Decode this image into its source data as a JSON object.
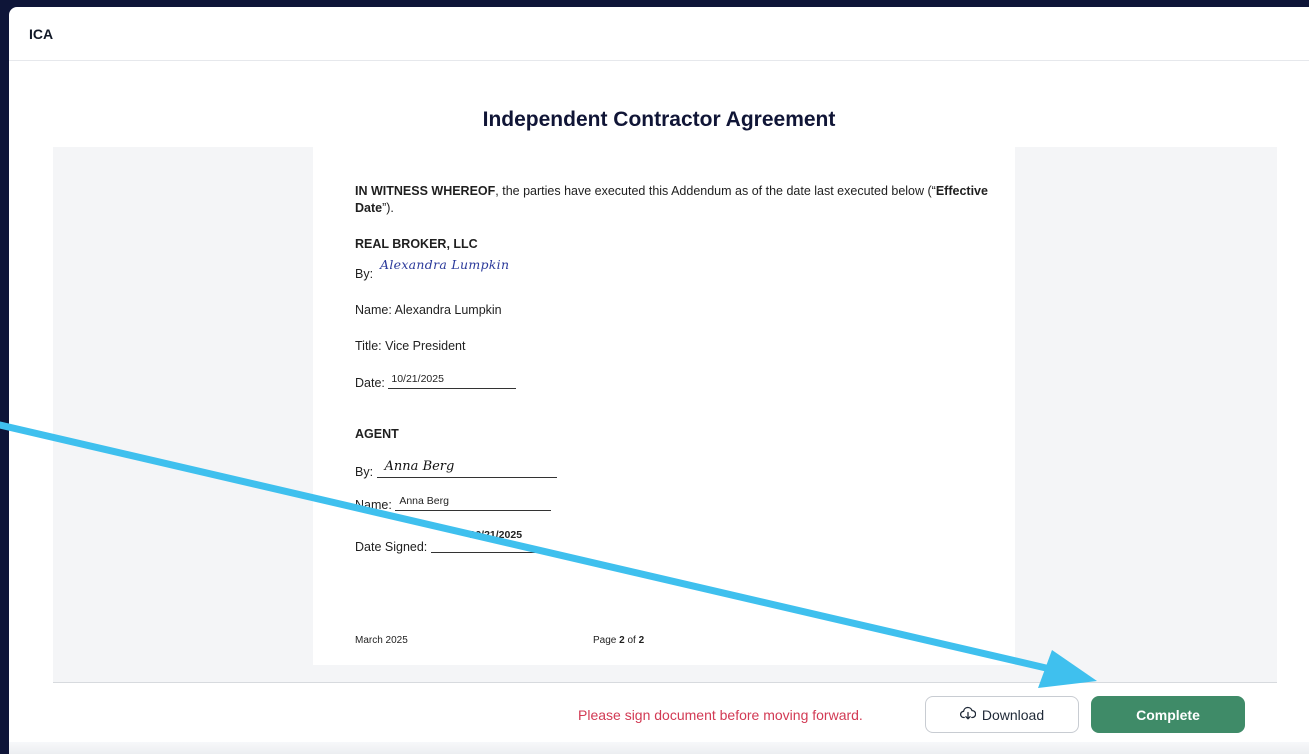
{
  "app": {
    "title": "ICA"
  },
  "document": {
    "heading": "Independent Contractor Agreement",
    "witness_bold": "IN WITNESS WHEREOF",
    "witness_text": ", the parties have executed this Addendum as of the date last executed below (“",
    "effective_bold": "Effective Date",
    "witness_end": "”).",
    "broker": {
      "heading": "REAL BROKER, LLC",
      "by_label": "By:",
      "signature": "Alexandra Lumpkin",
      "name_label": "Name:",
      "name_value": "Alexandra Lumpkin",
      "title_label": "Title:",
      "title_value": "Vice President",
      "date_label": "Date:",
      "date_value": "10/21/2025"
    },
    "agent": {
      "heading": "AGENT",
      "by_label": "By:",
      "signature": "Anna Berg",
      "name_label": "Name:",
      "name_value": "Anna Berg",
      "date_label": "Date Signed:",
      "date_value": "10/21/2025"
    },
    "footer": {
      "date": "March 2025",
      "page_label": "Page",
      "page_current": "2",
      "page_of": "of",
      "page_total": "2"
    }
  },
  "actions": {
    "warning": "Please sign document before moving forward.",
    "download_label": "Download",
    "complete_label": "Complete"
  },
  "colors": {
    "accent_green": "#3f8b68",
    "warning_red": "#d23a54",
    "arrow_blue": "#3fc0ee",
    "background_navy": "#0e1538"
  },
  "icons": {
    "download": "cloud-download-icon"
  }
}
